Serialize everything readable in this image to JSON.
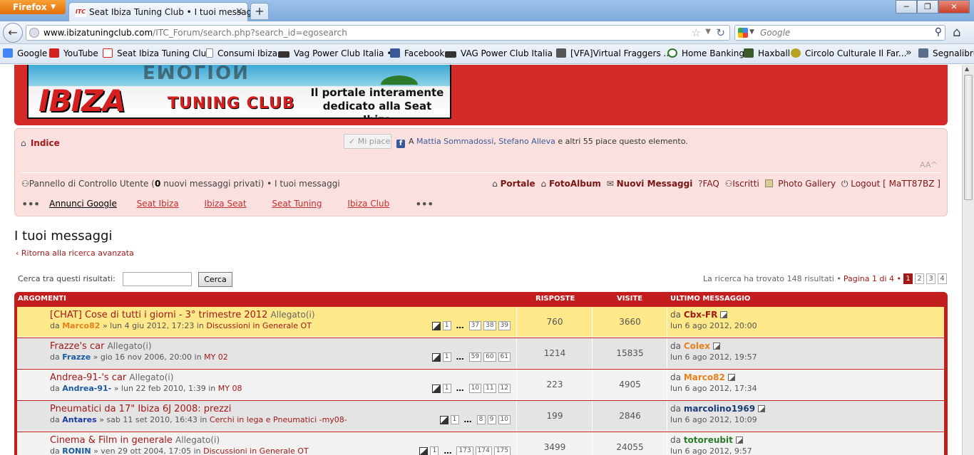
{
  "browser": {
    "menu_label": "Firefox",
    "tab_title": "Seat Ibiza Tuning Club • I tuoi messaggi",
    "tab_favicon_text": "ITC",
    "url_domain": "www.ibizatuningclub.com",
    "url_path": "/ITC_Forum/search.php?search_id=egosearch",
    "search_engine": "Google",
    "search_placeholder": "Google",
    "bookmarks": [
      {
        "label": "Google",
        "icon": "google-icon",
        "color": "#4285f4"
      },
      {
        "label": "YouTube",
        "icon": "youtube-icon",
        "color": "#d62020"
      },
      {
        "label": "Seat Ibiza Tuning Club",
        "icon": "itc-icon",
        "color": "#d62020"
      },
      {
        "label": "Consumi Ibiza",
        "icon": "document-icon",
        "color": "#888888"
      },
      {
        "label": "Vag Power Club Italia •...",
        "icon": "vag-icon",
        "color": "#333333"
      },
      {
        "label": "Facebook",
        "icon": "facebook-icon",
        "color": "#3b5998"
      },
      {
        "label": "VAG Power Club Italia ...",
        "icon": "vag-icon",
        "color": "#333333"
      },
      {
        "label": "[VFA]Virtual Fraggers ...",
        "icon": "vfa-icon",
        "color": "#555555"
      },
      {
        "label": "Home Banking",
        "icon": "bank-icon",
        "color": "#2a7a2a"
      },
      {
        "label": "Haxball",
        "icon": "haxball-icon",
        "color": "#3a5a2a"
      },
      {
        "label": "Circolo Culturale Il Far...",
        "icon": "circle-icon",
        "color": "#b8a020"
      }
    ],
    "bookmarks_more": "»",
    "bookmarks_folder": "Segnalibri"
  },
  "banner": {
    "mirror_text": "EMOLION",
    "brand_main": "IBIZA",
    "brand_sub": "TUNING CLUB",
    "tagline_1": "Il portale interamente",
    "tagline_2": "dedicato alla Seat Ibiza"
  },
  "nav": {
    "home_label": "Indice",
    "like_button": "Mi piace",
    "like_prefix": "A ",
    "like_name_1": "Mattia Sommadossi",
    "like_sep": ", ",
    "like_name_2": "Stefano Alleva",
    "like_suffix": " e altri 55 piace questo elemento.",
    "font_size": "AA^",
    "ucp_label": "Pannello di Controllo Utente (",
    "ucp_count": "0",
    "ucp_suffix": " nuovi messaggi privati) •",
    "own_posts": "I tuoi messaggi",
    "right_links": {
      "portal": "Portale",
      "album": "FotoAlbum",
      "new_posts": "Nuovi Messaggi",
      "faq": "FAQ",
      "members": "Iscritti",
      "gallery": "Photo Gallery",
      "logout": "Logout [ MaTT87BZ ]"
    },
    "ads_header": "Annunci Google",
    "ads": [
      "Seat Ibiza",
      "Ibiza Seat",
      "Seat Tuning",
      "Ibiza Club"
    ]
  },
  "page": {
    "title": "I tuoi messaggi",
    "back_link": "Ritorna alla ricerca avanzata",
    "search_label": "Cerca tra questi risultati:",
    "search_value": "",
    "search_button": "Cerca",
    "results_text": "La ricerca ha trovato 148 risultati •",
    "page_text": "Pagina 1 di 4 •",
    "pages": [
      "1",
      "2",
      "3",
      "4"
    ],
    "current_page": "1"
  },
  "table": {
    "headers": {
      "topics": "ARGOMENTI",
      "replies": "RISPOSTE",
      "views": "VISITE",
      "last": "ULTIMO MESSAGGIO"
    },
    "rows": [
      {
        "title": "[CHAT] Cose di tutti i giorni - 3° trimestre 2012",
        "attachment": "Allegato(i)",
        "by_prefix": "da",
        "author": "Marco82",
        "author_color": "#e8801a",
        "date": "» lun 4 giu 2012, 17:23 in",
        "forum": "Discussioni in Generale OT",
        "pages": [
          "1",
          "37",
          "38",
          "39"
        ],
        "replies": "760",
        "views": "3660",
        "last_by": "da",
        "last_user": "Cbx-FR",
        "last_user_color": "#a21818",
        "last_date": "lun 6 ago 2012, 20:00",
        "bg": "#fde88a"
      },
      {
        "title": "Frazze's car",
        "attachment": "Allegato(i)",
        "by_prefix": "da",
        "author": "Frazze",
        "author_color": "#1a5aa0",
        "date": "» gio 16 nov 2006, 20:00 in",
        "forum": "MY 02",
        "pages": [
          "1",
          "59",
          "60",
          "61"
        ],
        "replies": "1214",
        "views": "15835",
        "last_by": "da",
        "last_user": "Colex",
        "last_user_color": "#e8801a",
        "last_date": "lun 6 ago 2012, 19:57",
        "bg": "#e4e4e4"
      },
      {
        "title": "Andrea-91-'s car",
        "attachment": "Allegato(i)",
        "by_prefix": "da",
        "author": "Andrea-91-",
        "author_color": "#1a5aa0",
        "date": "» lun 22 feb 2010, 1:39 in",
        "forum": "MY 08",
        "pages": [
          "1",
          "10",
          "11",
          "12"
        ],
        "replies": "223",
        "views": "4905",
        "last_by": "da",
        "last_user": "Marco82",
        "last_user_color": "#e8801a",
        "last_date": "lun 6 ago 2012, 17:34",
        "bg": "#f2f2f2"
      },
      {
        "title": "Pneumatici da 17\" Ibiza 6J 2008: prezzi",
        "attachment": "",
        "by_prefix": "da",
        "author": "Antares",
        "author_color": "#1a3aa0",
        "date": "» sab 11 set 2010, 16:43 in",
        "forum": "Cerchi in lega e Pneumatici -my08-",
        "pages": [
          "1",
          "8",
          "9",
          "10"
        ],
        "replies": "199",
        "views": "2846",
        "last_by": "da",
        "last_user": "marcolino1969",
        "last_user_color": "#1a3a7a",
        "last_date": "lun 6 ago 2012, 10:09",
        "bg": "#e4e4e4"
      },
      {
        "title": "Cinema & Film in generale",
        "attachment": "Allegato(i)",
        "by_prefix": "da",
        "author": "RONIN",
        "author_color": "#1a5aa0",
        "date": "» ven 29 ott 2004, 17:05 in",
        "forum": "Discussioni in Generale OT",
        "pages": [
          "1",
          "173",
          "174",
          "175"
        ],
        "replies": "3499",
        "views": "24055",
        "last_by": "da",
        "last_user": "totoreubit",
        "last_user_color": "#2a7a2a",
        "last_date": "lun 6 ago 2012, 9:57",
        "bg": "#f2f2f2"
      }
    ]
  }
}
